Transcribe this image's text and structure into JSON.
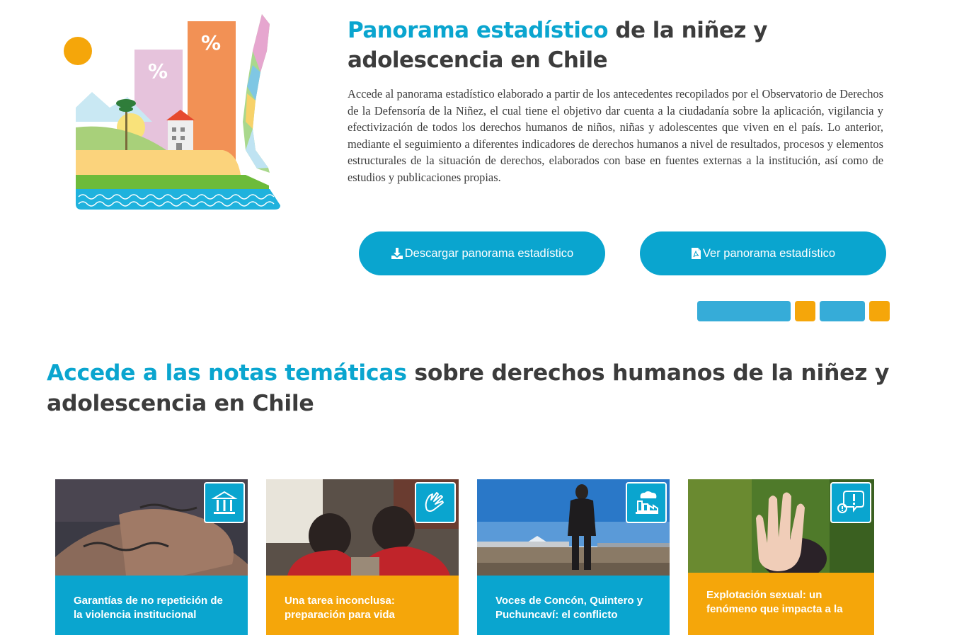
{
  "hero": {
    "title_accent": "Panorama estadístico",
    "title_rest": " de la niñez y adolescencia en Chile",
    "description": "Accede al panorama estadístico elaborado a partir de los antecedentes recopilados por el Observatorio de Derechos de la Defensoría de la Niñez, el cual tiene el objetivo dar cuenta a la ciudadanía sobre la aplicación, vigilancia y efectivización de todos los derechos humanos de niños, niñas y adolescentes que viven en el país. Lo anterior, mediante el seguimiento a diferentes indicadores de derechos humanos a nivel de resultados, procesos y elementos estructurales de la situación de derechos, elaborados con base en fuentes externas a la institución, así como de estudios y publicaciones propias.",
    "illustration": {
      "bar_label_1": "%",
      "bar_label_2": "%"
    },
    "download_button": "Descargar panorama estadístico",
    "view_button": "Ver panorama estadístico"
  },
  "carousel": {
    "active_slide": 1,
    "colors": {
      "blue": "#36acd8",
      "orange": "#f5a60a"
    }
  },
  "notes": {
    "title_accent": "Accede a las notas temáticas",
    "title_rest": " sobre derechos humanos de la niñez y adolescencia en Chile",
    "cards": [
      {
        "caption": "Garantías de no repetición de la violencia institucional",
        "icon": "institution-icon",
        "color": "#0aa5cf"
      },
      {
        "caption": "Una tarea inconclusa: preparación para vida",
        "icon": "hands-icon",
        "color": "#f5a60a"
      },
      {
        "caption": "Voces de Concón, Quintero y Puchuncaví: el conflicto",
        "icon": "factory-pollution-icon",
        "color": "#0aa5cf"
      },
      {
        "caption": "Explotación sexual: un fenómeno que impacta a la",
        "icon": "alert-person-icon",
        "color": "#f5a60a"
      }
    ]
  },
  "colors": {
    "accent": "#0aa5cf",
    "orange": "#f5a60a",
    "text": "#3c3c3c"
  }
}
